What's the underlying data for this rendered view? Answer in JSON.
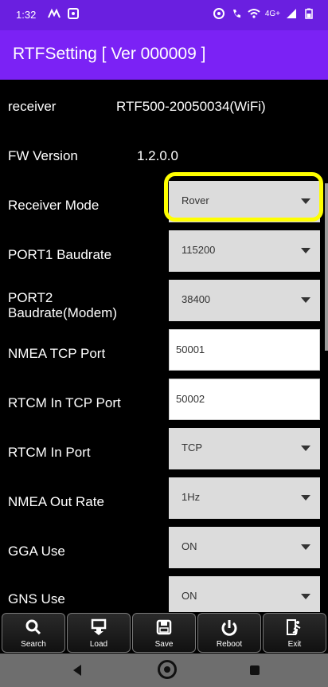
{
  "status": {
    "time": "1:32",
    "network": "4G+"
  },
  "app": {
    "title": "RTFSetting  [ Ver 000009 ]"
  },
  "settings": {
    "receiver": {
      "label": "receiver",
      "value": "RTF500-20050034(WiFi)"
    },
    "fw": {
      "label": "FW Version",
      "value": "1.2.0.0"
    },
    "receiver_mode": {
      "label": "Receiver Mode",
      "value": "Rover"
    },
    "port1": {
      "label": "PORT1 Baudrate",
      "value": "115200"
    },
    "port2": {
      "label": "PORT2\nBaudrate(Modem)",
      "value": "38400"
    },
    "nmea_tcp": {
      "label": "NMEA TCP Port",
      "value": "50001"
    },
    "rtcm_tcp": {
      "label": "RTCM In TCP Port",
      "value": "50002"
    },
    "rtcm_in": {
      "label": "RTCM In Port",
      "value": "TCP"
    },
    "nmea_rate": {
      "label": "NMEA Out Rate",
      "value": "1Hz"
    },
    "gga": {
      "label": "GGA Use",
      "value": "ON"
    },
    "gns": {
      "label": "GNS Use",
      "value": "ON"
    }
  },
  "toolbar": {
    "search": "Search",
    "load": "Load",
    "save": "Save",
    "reboot": "Reboot",
    "exit": "Exit"
  },
  "colors": {
    "statusbar": "#6a1fe0",
    "appbar": "#7b22f5",
    "highlight": "#ffff00"
  }
}
